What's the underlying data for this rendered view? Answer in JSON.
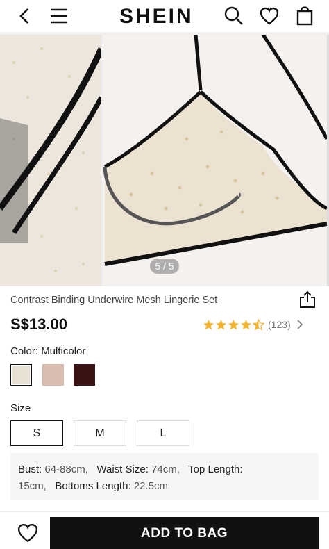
{
  "header": {
    "logo": "SHEIN",
    "icons": [
      "back-icon",
      "menu-icon",
      "search-icon",
      "heart-icon",
      "bag-icon"
    ]
  },
  "gallery": {
    "pager": "5 / 5"
  },
  "product": {
    "title": "Contrast Binding Underwire Mesh Lingerie Set",
    "price": "S$13.00",
    "rating": 4.5,
    "rating_count": "(123)",
    "star_color": "#f6b530"
  },
  "color": {
    "label": "Color:",
    "value": "Multicolor",
    "swatches": [
      {
        "name": "nude-mesh",
        "color": "#e8e0d2",
        "selected": true
      },
      {
        "name": "pink-dot",
        "color": "#d8bcb0",
        "selected": false
      },
      {
        "name": "burgundy-black",
        "color": "#3a1414",
        "selected": false
      }
    ]
  },
  "size": {
    "label": "Size",
    "options": [
      "S",
      "M",
      "L"
    ],
    "selected": "S"
  },
  "measurements": {
    "bust_label": "Bust:",
    "bust_value": "64-88cm,",
    "waist_label": "Waist Size:",
    "waist_value": "74cm,",
    "top_label": "Top Length:",
    "top_value": "15cm,",
    "bottoms_label": "Bottoms Length:",
    "bottoms_value": "22.5cm"
  },
  "bottom": {
    "add_to_bag": "ADD TO BAG"
  }
}
